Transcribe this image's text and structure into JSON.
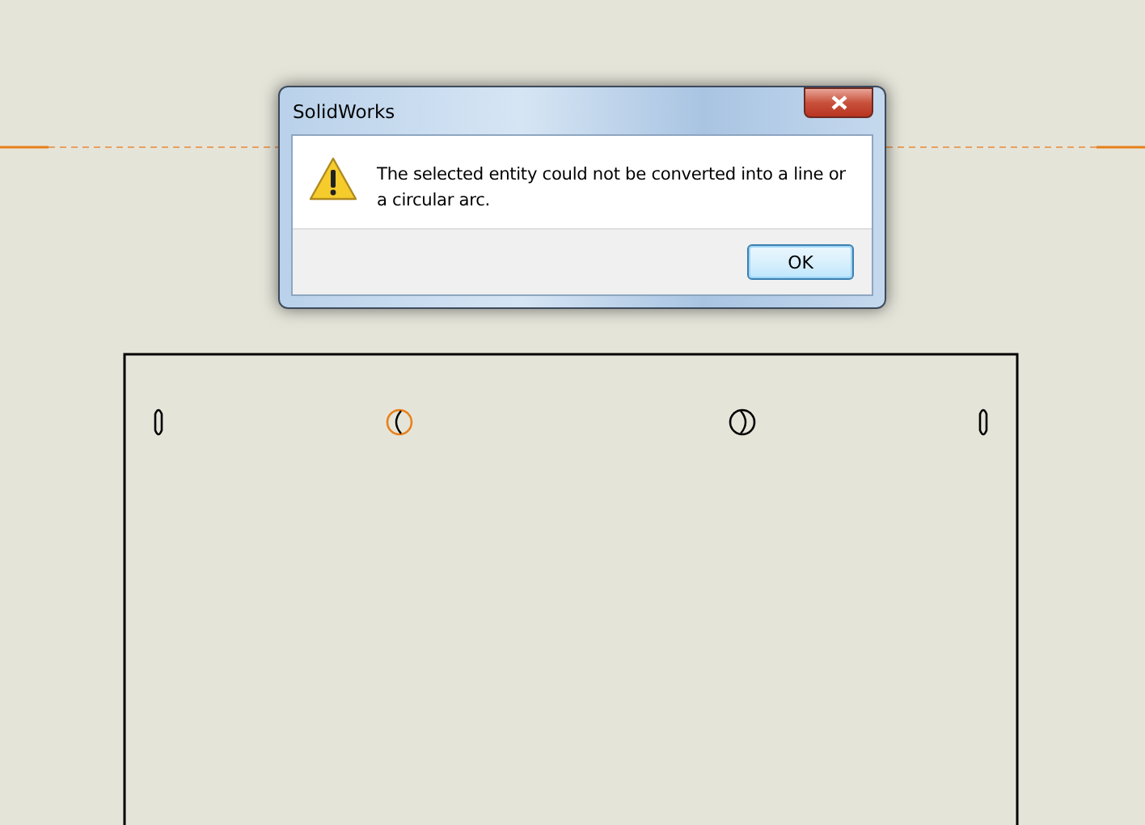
{
  "dialog": {
    "title": "SolidWorks",
    "message": "The selected entity could not be converted into a line or a circular arc.",
    "buttons": [
      {
        "label": "OK",
        "default": true
      }
    ]
  },
  "sketch": {
    "entities": [
      {
        "kind": "slot",
        "selected": false
      },
      {
        "kind": "circle",
        "selected": true
      },
      {
        "kind": "circle-mirrored",
        "selected": false
      },
      {
        "kind": "slot",
        "selected": false
      }
    ]
  }
}
